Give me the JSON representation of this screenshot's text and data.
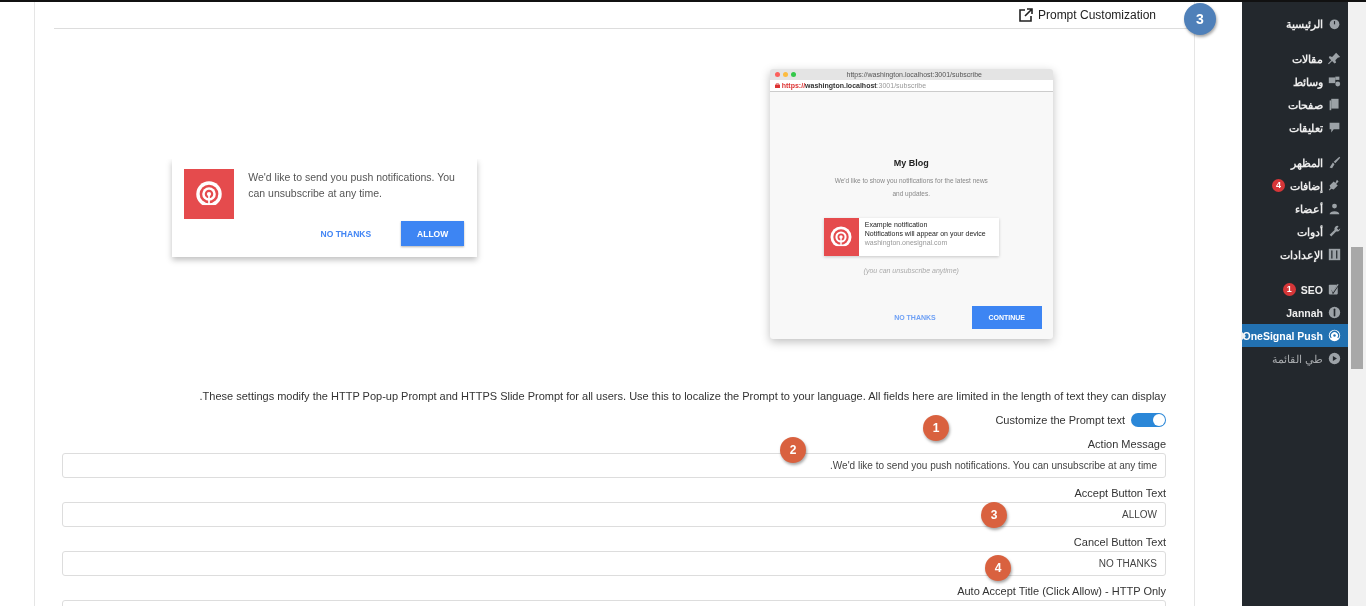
{
  "header": {
    "badge": "3",
    "title": "Prompt Customization"
  },
  "previews": {
    "popup": {
      "message": "We'd like to send you push notifications. You can unsubscribe at any time.",
      "buttons": [
        {
          "label": "NO THANKS",
          "kind": "text"
        },
        {
          "label": "ALLOW",
          "kind": "primary"
        }
      ]
    },
    "slide": {
      "window_title": "https://washington.localhost:3001/subscribe",
      "url": {
        "scheme": "https://",
        "host": "washington.localhost",
        "path": ":3001/subscribe"
      },
      "title": "My Blog",
      "message": "We'd like to show you notifications for the latest news and updates.",
      "notification": {
        "title": "Example notification",
        "body": "Notifications will appear on your device",
        "site": "washington.onesignal.com"
      },
      "note": "(you can unsubscribe anytime)",
      "buttons": [
        {
          "label": "NO THANKS",
          "kind": "text"
        },
        {
          "label": "CONTINUE",
          "kind": "primary"
        }
      ]
    }
  },
  "description": "These settings modify the HTTP Pop-up Prompt and HTTPS Slide Prompt for all users. Use this to localize the Prompt to your language. All fields here are limited in the length of text they can display.",
  "toggle": {
    "label": "Customize the Prompt text",
    "on": true
  },
  "fields": [
    {
      "label": "Action Message",
      "value": "We'd like to send you push notifications. You can unsubscribe at any time."
    },
    {
      "label": "Accept Button Text",
      "value": "ALLOW"
    },
    {
      "label": "Cancel Button Text",
      "value": "NO THANKS"
    },
    {
      "label": "Auto Accept Title (Click Allow) - HTTP Only"
    }
  ],
  "annotations": [
    "1",
    "2",
    "3",
    "4"
  ],
  "sidebar": {
    "groups": [
      [
        {
          "label": "الرئيسية",
          "selected": false
        }
      ],
      [
        {
          "label": "مقالات",
          "selected": false
        },
        {
          "label": "وسائط",
          "selected": false
        },
        {
          "label": "صفحات",
          "selected": false
        },
        {
          "label": "تعليقات",
          "selected": false
        }
      ],
      [
        {
          "label": "المظهر",
          "selected": false
        },
        {
          "label": "إضافات",
          "badge": "4",
          "selected": false
        },
        {
          "label": "أعضاء",
          "selected": false
        },
        {
          "label": "أدوات",
          "selected": false
        },
        {
          "label": "الإعدادات",
          "selected": false
        }
      ],
      [
        {
          "label": "SEO",
          "badge": "1",
          "selected": false
        },
        {
          "label": "Jannah",
          "selected": false
        },
        {
          "label": "OneSignal Push",
          "selected": true
        },
        {
          "label": "طي القائمة",
          "kind": "collapse",
          "selected": false
        }
      ]
    ]
  }
}
